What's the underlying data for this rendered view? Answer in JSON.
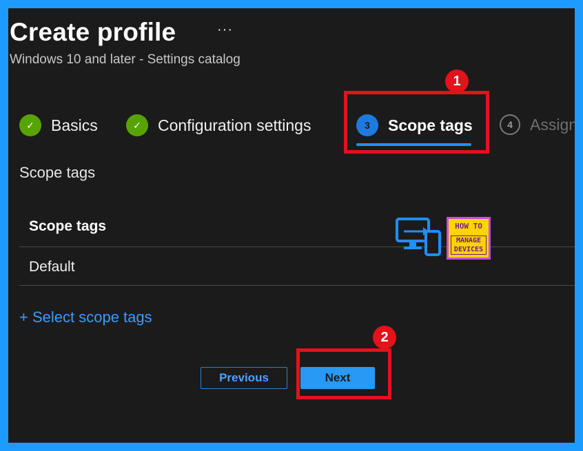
{
  "header": {
    "title": "Create profile",
    "more_label": "···",
    "subtitle": "Windows 10 and later - Settings catalog"
  },
  "wizard": {
    "steps": [
      {
        "number": "✓",
        "label": "Basics",
        "state": "done"
      },
      {
        "number": "✓",
        "label": "Configuration settings",
        "state": "done"
      },
      {
        "number": "3",
        "label": "Scope tags",
        "state": "current"
      },
      {
        "number": "4",
        "label": "Assignments",
        "state": "todo"
      }
    ]
  },
  "section": {
    "label": "Scope tags",
    "table_header": "Scope tags",
    "rows": [
      "Default"
    ],
    "select_link": "+ Select scope tags"
  },
  "footer": {
    "previous_label": "Previous",
    "next_label": "Next"
  },
  "annotations": {
    "badge_1": "1",
    "badge_2": "2"
  },
  "watermark": {
    "line1": "HOW TO",
    "line2": "MANAGE DEVICES"
  },
  "colors": {
    "background": "#1c1b1b",
    "frame_border": "#1e9bff",
    "accent": "#1f8fff",
    "success": "#57a300",
    "highlight": "#e3121b"
  }
}
